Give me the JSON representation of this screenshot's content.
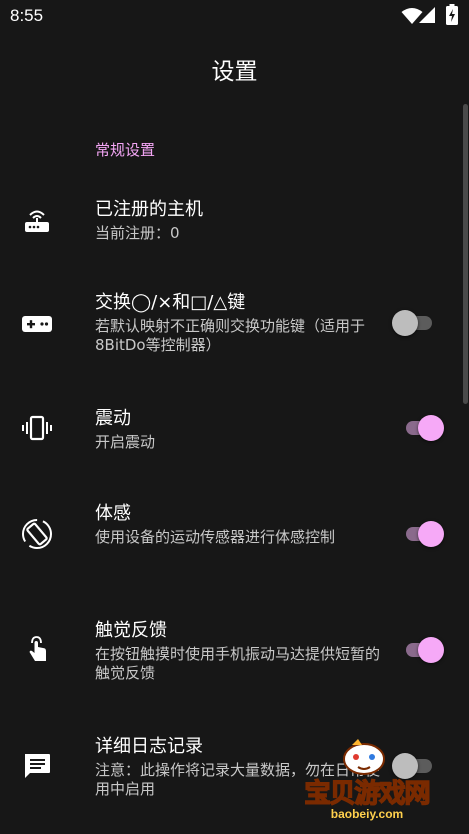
{
  "status_bar": {
    "time": "8:55",
    "icons": [
      "wifi-icon",
      "signal-icon",
      "battery-charging-icon"
    ]
  },
  "toolbar": {
    "title": "设置"
  },
  "section": {
    "header": "常规设置"
  },
  "rows": [
    {
      "icon": "router-icon",
      "title": "已注册的主机",
      "summary": "当前注册：0",
      "has_switch": false
    },
    {
      "icon": "gamepad-icon",
      "title": "交换◯/×和□/△键",
      "summary": "若默认映射不正确则交换功能键（适用于8BitDo等控制器）",
      "has_switch": true,
      "checked": false
    },
    {
      "icon": "vibration-icon",
      "title": "震动",
      "summary": "开启震动",
      "has_switch": true,
      "checked": true
    },
    {
      "icon": "screen-rotation-icon",
      "title": "体感",
      "summary": "使用设备的运动传感器进行体感控制",
      "has_switch": true,
      "checked": true
    },
    {
      "icon": "touch-icon",
      "title": "触觉反馈",
      "summary": "在按钮触摸时使用手机振动马达提供短暂的触觉反馈",
      "has_switch": true,
      "checked": true
    },
    {
      "icon": "feedback-icon",
      "title": "详细日志记录",
      "summary": "注意：此操作将记录大量数据，勿在日常使用中启用",
      "has_switch": true,
      "checked": false
    }
  ],
  "watermark": {
    "text": "宝贝游戏网",
    "url": "baobeiy.com"
  },
  "colors": {
    "accent": "#f6a9f7",
    "background": "#171717",
    "summary_text": "#c8c8c8"
  }
}
